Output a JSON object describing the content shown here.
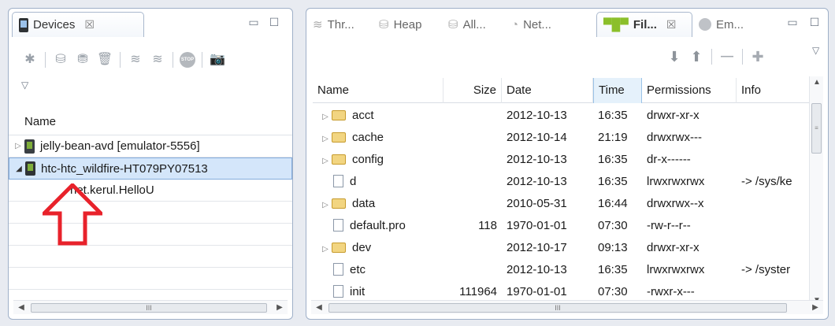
{
  "left_panel": {
    "tab": {
      "title": "Devices",
      "close": "☒"
    },
    "window_buttons": {
      "minimize": "▭",
      "maximize": "☐"
    },
    "view_menu": "▽",
    "column_header": "Name",
    "tree": [
      {
        "label": "jelly-bean-avd [emulator-5556]",
        "expanded": false
      },
      {
        "label": "htc-htc_wildfire-HT079PY07513",
        "expanded": true,
        "selected": true
      },
      {
        "label": "net.kerul.HelloU",
        "child": true
      }
    ],
    "hscroll": {
      "left": "◀",
      "right": "▶",
      "thumb": "III"
    }
  },
  "right_panel": {
    "tabs": [
      {
        "label": "Thr...",
        "icon": "threads-icon"
      },
      {
        "label": "Heap",
        "icon": "heap-icon"
      },
      {
        "label": "All...",
        "icon": "allocation-icon"
      },
      {
        "label": "Net...",
        "icon": "network-icon"
      },
      {
        "label": "Fil...",
        "icon": "android-icon",
        "active": true
      },
      {
        "label": "Em...",
        "icon": "emulator-icon"
      }
    ],
    "tab_close": "☒",
    "window_buttons": {
      "minimize": "▭",
      "maximize": "☐"
    },
    "view_menu": "▽",
    "toolbar": {
      "pull": "⬇",
      "push": "⬆",
      "delete": "—",
      "new_folder": "✚"
    },
    "columns": [
      "Name",
      "Size",
      "Date",
      "Time",
      "Permissions",
      "Info"
    ],
    "sorted_column": "Time",
    "rows": [
      {
        "name": "acct",
        "type": "folder",
        "size": "",
        "date": "2012-10-13",
        "time": "16:35",
        "perms": "drwxr-xr-x",
        "info": ""
      },
      {
        "name": "cache",
        "type": "folder",
        "size": "",
        "date": "2012-10-14",
        "time": "21:19",
        "perms": "drwxrwx---",
        "info": ""
      },
      {
        "name": "config",
        "type": "folder",
        "size": "",
        "date": "2012-10-13",
        "time": "16:35",
        "perms": "dr-x------",
        "info": ""
      },
      {
        "name": "d",
        "type": "file",
        "size": "",
        "date": "2012-10-13",
        "time": "16:35",
        "perms": "lrwxrwxrwx",
        "info": "-> /sys/ke"
      },
      {
        "name": "data",
        "type": "folder",
        "size": "",
        "date": "2010-05-31",
        "time": "16:44",
        "perms": "drwxrwx--x",
        "info": ""
      },
      {
        "name": "default.pro",
        "type": "file",
        "size": "118",
        "date": "1970-01-01",
        "time": "07:30",
        "perms": "-rw-r--r--",
        "info": ""
      },
      {
        "name": "dev",
        "type": "folder",
        "size": "",
        "date": "2012-10-17",
        "time": "09:13",
        "perms": "drwxr-xr-x",
        "info": ""
      },
      {
        "name": "etc",
        "type": "file",
        "size": "",
        "date": "2012-10-13",
        "time": "16:35",
        "perms": "lrwxrwxrwx",
        "info": "-> /syster"
      },
      {
        "name": "init",
        "type": "file",
        "size": "111964",
        "date": "1970-01-01",
        "time": "07:30",
        "perms": "-rwxr-x---",
        "info": ""
      }
    ],
    "vscroll": {
      "up": "▲",
      "down": "▼",
      "thumb": "≡"
    },
    "hscroll": {
      "left": "◀",
      "right": "▶",
      "thumb": "III"
    }
  },
  "annotation": {
    "color": "#e8222b"
  }
}
